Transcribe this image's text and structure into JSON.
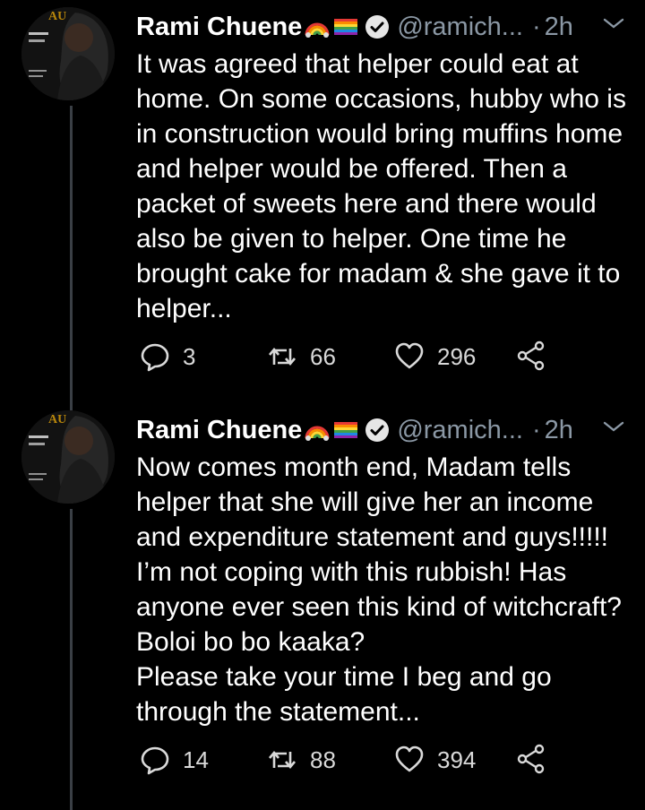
{
  "tweets": [
    {
      "name": "Rami Chuene",
      "handle": "@ramich...",
      "time": "2h",
      "text": "It was agreed that helper could eat at home. On some occasions, hubby who is in construction would bring muffins home and helper would be offered. Then a packet of sweets here and there would also be given to helper. One time he brought cake for madam & she gave it to helper...",
      "replies": "3",
      "retweets": "66",
      "likes": "296"
    },
    {
      "name": "Rami Chuene",
      "handle": "@ramich...",
      "time": "2h",
      "text": "Now comes month end, Madam tells helper that she will give her an income and expenditure statement and guys!!!!! I’m not coping with this rubbish! Has anyone ever seen this kind of witchcraft? Boloi bo bo kaaka?\nPlease take your time I beg and go through the statement...",
      "replies": "14",
      "retweets": "88",
      "likes": "394"
    }
  ],
  "colors": {
    "background": "#000000",
    "muted": "#8b98a5",
    "thread_line": "#3a3f45"
  },
  "icons": [
    "avatar",
    "rainbow-emoji",
    "pride-flag-emoji",
    "verified-badge-icon",
    "chevron-down-icon",
    "reply-icon",
    "retweet-icon",
    "like-icon",
    "share-icon"
  ]
}
